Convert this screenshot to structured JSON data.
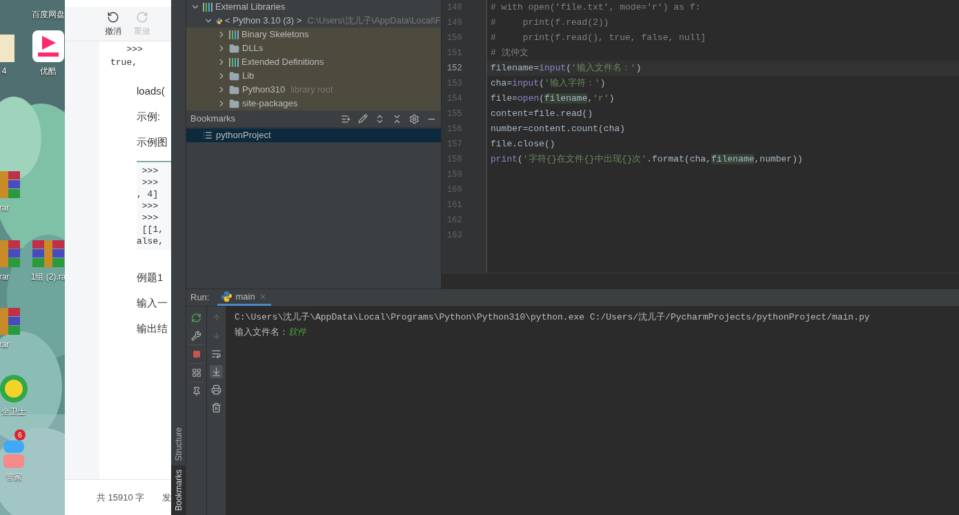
{
  "desktop": {
    "icons": [
      {
        "label": "百度网盘",
        "kind": "cloud"
      },
      {
        "label": "4",
        "kind": "file"
      },
      {
        "label": "优酷",
        "kind": "video"
      },
      {
        "label": "rar",
        "kind": "archive"
      },
      {
        "label": "rar",
        "kind": "archive"
      },
      {
        "label": "1组 (2).ra",
        "kind": "archive"
      },
      {
        "label": "rar",
        "kind": "archive"
      },
      {
        "label": "全卫士",
        "kind": "shield"
      },
      {
        "label": "管家",
        "kind": "manager",
        "badge": "6"
      }
    ]
  },
  "document": {
    "toolbar": [
      {
        "label": "撤消",
        "kind": "undo",
        "disabled": false
      },
      {
        "label": "重做",
        "kind": "redo",
        "disabled": true
      }
    ],
    "blocks": [
      {
        "kind": "code",
        "lines": [
          "   >>>",
          "true,"
        ]
      },
      {
        "kind": "para",
        "text": "loads("
      },
      {
        "kind": "para",
        "text": "示例:"
      },
      {
        "kind": "para",
        "text": "示例图"
      },
      {
        "kind": "codebox",
        "lines": [
          " >>>",
          " >>>",
          ", 4]",
          " >>>",
          " >>>",
          " [[1,",
          "alse,"
        ]
      },
      {
        "kind": "para",
        "text": "例题1"
      },
      {
        "kind": "para",
        "text": "输入一"
      },
      {
        "kind": "para",
        "text": "输出结"
      }
    ],
    "footer": [
      "共 15910 字",
      "发"
    ]
  },
  "tool_strip": [
    {
      "label": "Structure",
      "selected": false
    },
    {
      "label": "Bookmarks",
      "selected": true
    }
  ],
  "project_tree": [
    {
      "label": "External Libraries",
      "kind": "library",
      "expanded": true,
      "highlighted": false,
      "children": [
        {
          "label": "< Python 3.10 (3) >",
          "kind": "python",
          "expanded": true,
          "highlighted": false,
          "hint": "C:\\Users\\沈儿子\\AppData\\Local\\F",
          "children": [
            {
              "label": "Binary Skeletons",
              "kind": "library",
              "expanded": false,
              "highlighted": true
            },
            {
              "label": "DLLs",
              "kind": "folder",
              "expanded": false,
              "highlighted": true
            },
            {
              "label": "Extended Definitions",
              "kind": "library",
              "expanded": false,
              "highlighted": true
            },
            {
              "label": "Lib",
              "kind": "folder",
              "expanded": false,
              "highlighted": true
            },
            {
              "label": "Python310",
              "kind": "folder",
              "expanded": false,
              "highlighted": true,
              "hint": "library root"
            },
            {
              "label": "site-packages",
              "kind": "folder",
              "expanded": false,
              "highlighted": true
            }
          ]
        }
      ]
    }
  ],
  "bookmarks": {
    "title": "Bookmarks",
    "items": [
      {
        "label": "pythonProject",
        "selected": true
      }
    ]
  },
  "editor": {
    "lines": [
      {
        "number": "148",
        "current": false,
        "tokens": [
          {
            "kind": "comment",
            "text": "# with open('file.txt', mode='r') as f:"
          }
        ]
      },
      {
        "number": "149",
        "current": false,
        "tokens": [
          {
            "kind": "comment",
            "text": "#     print(f.read(2))"
          }
        ]
      },
      {
        "number": "150",
        "current": false,
        "tokens": [
          {
            "kind": "comment",
            "text": "#     print(f.read(), true, false, null]"
          }
        ]
      },
      {
        "number": "151",
        "current": false,
        "tokens": [
          {
            "kind": "comment",
            "text": "# 沈仲文"
          }
        ]
      },
      {
        "number": "152",
        "current": true,
        "tokens": [
          {
            "kind": "plain",
            "text": "filename"
          },
          {
            "kind": "plain",
            "text": "="
          },
          {
            "kind": "builtin",
            "text": "input"
          },
          {
            "kind": "plain",
            "text": "("
          },
          {
            "kind": "string",
            "text": "'输入文件名：'"
          },
          {
            "kind": "plain",
            "text": ")"
          }
        ]
      },
      {
        "number": "153",
        "current": false,
        "tokens": [
          {
            "kind": "plain",
            "text": "cha"
          },
          {
            "kind": "plain",
            "text": "="
          },
          {
            "kind": "builtin",
            "text": "input"
          },
          {
            "kind": "plain",
            "text": "("
          },
          {
            "kind": "string",
            "text": "'输入字符：'"
          },
          {
            "kind": "plain",
            "text": ")"
          }
        ]
      },
      {
        "number": "154",
        "current": false,
        "tokens": [
          {
            "kind": "plain",
            "text": "file"
          },
          {
            "kind": "plain",
            "text": "="
          },
          {
            "kind": "builtin",
            "text": "open"
          },
          {
            "kind": "plain",
            "text": "("
          },
          {
            "kind": "ref",
            "text": "filename"
          },
          {
            "kind": "plain",
            "text": ","
          },
          {
            "kind": "string",
            "text": "'r'"
          },
          {
            "kind": "plain",
            "text": ")"
          }
        ]
      },
      {
        "number": "155",
        "current": false,
        "tokens": [
          {
            "kind": "plain",
            "text": "content=file.read()"
          }
        ]
      },
      {
        "number": "156",
        "current": false,
        "tokens": [
          {
            "kind": "plain",
            "text": "number=content.count(cha)"
          }
        ]
      },
      {
        "number": "157",
        "current": false,
        "tokens": [
          {
            "kind": "plain",
            "text": "file.close()"
          }
        ]
      },
      {
        "number": "158",
        "current": false,
        "tokens": [
          {
            "kind": "builtin",
            "text": "print"
          },
          {
            "kind": "plain",
            "text": "("
          },
          {
            "kind": "string",
            "text": "'字符{}在文件{}中出现{}次'"
          },
          {
            "kind": "plain",
            "text": ".format(cha,"
          },
          {
            "kind": "ref",
            "text": "filename"
          },
          {
            "kind": "plain",
            "text": ",number))"
          }
        ]
      },
      {
        "number": "159",
        "current": false
      },
      {
        "number": "160",
        "current": false
      },
      {
        "number": "161",
        "current": false
      },
      {
        "number": "162",
        "current": false
      },
      {
        "number": "163",
        "current": false
      }
    ]
  },
  "run": {
    "title": "Run:",
    "tabs": [
      {
        "label": "main",
        "selected": true
      }
    ],
    "output": [
      {
        "segments": [
          {
            "kind": "plain",
            "text": "C:\\Users\\沈儿子\\AppData\\Local\\Programs\\Python\\Python310\\python.exe C:/Users/沈儿子/PycharmProjects/pythonProject/main.py"
          }
        ]
      },
      {
        "segments": [
          {
            "kind": "plain",
            "text": "输入文件名："
          },
          {
            "kind": "input",
            "text": "软件"
          }
        ]
      }
    ]
  }
}
